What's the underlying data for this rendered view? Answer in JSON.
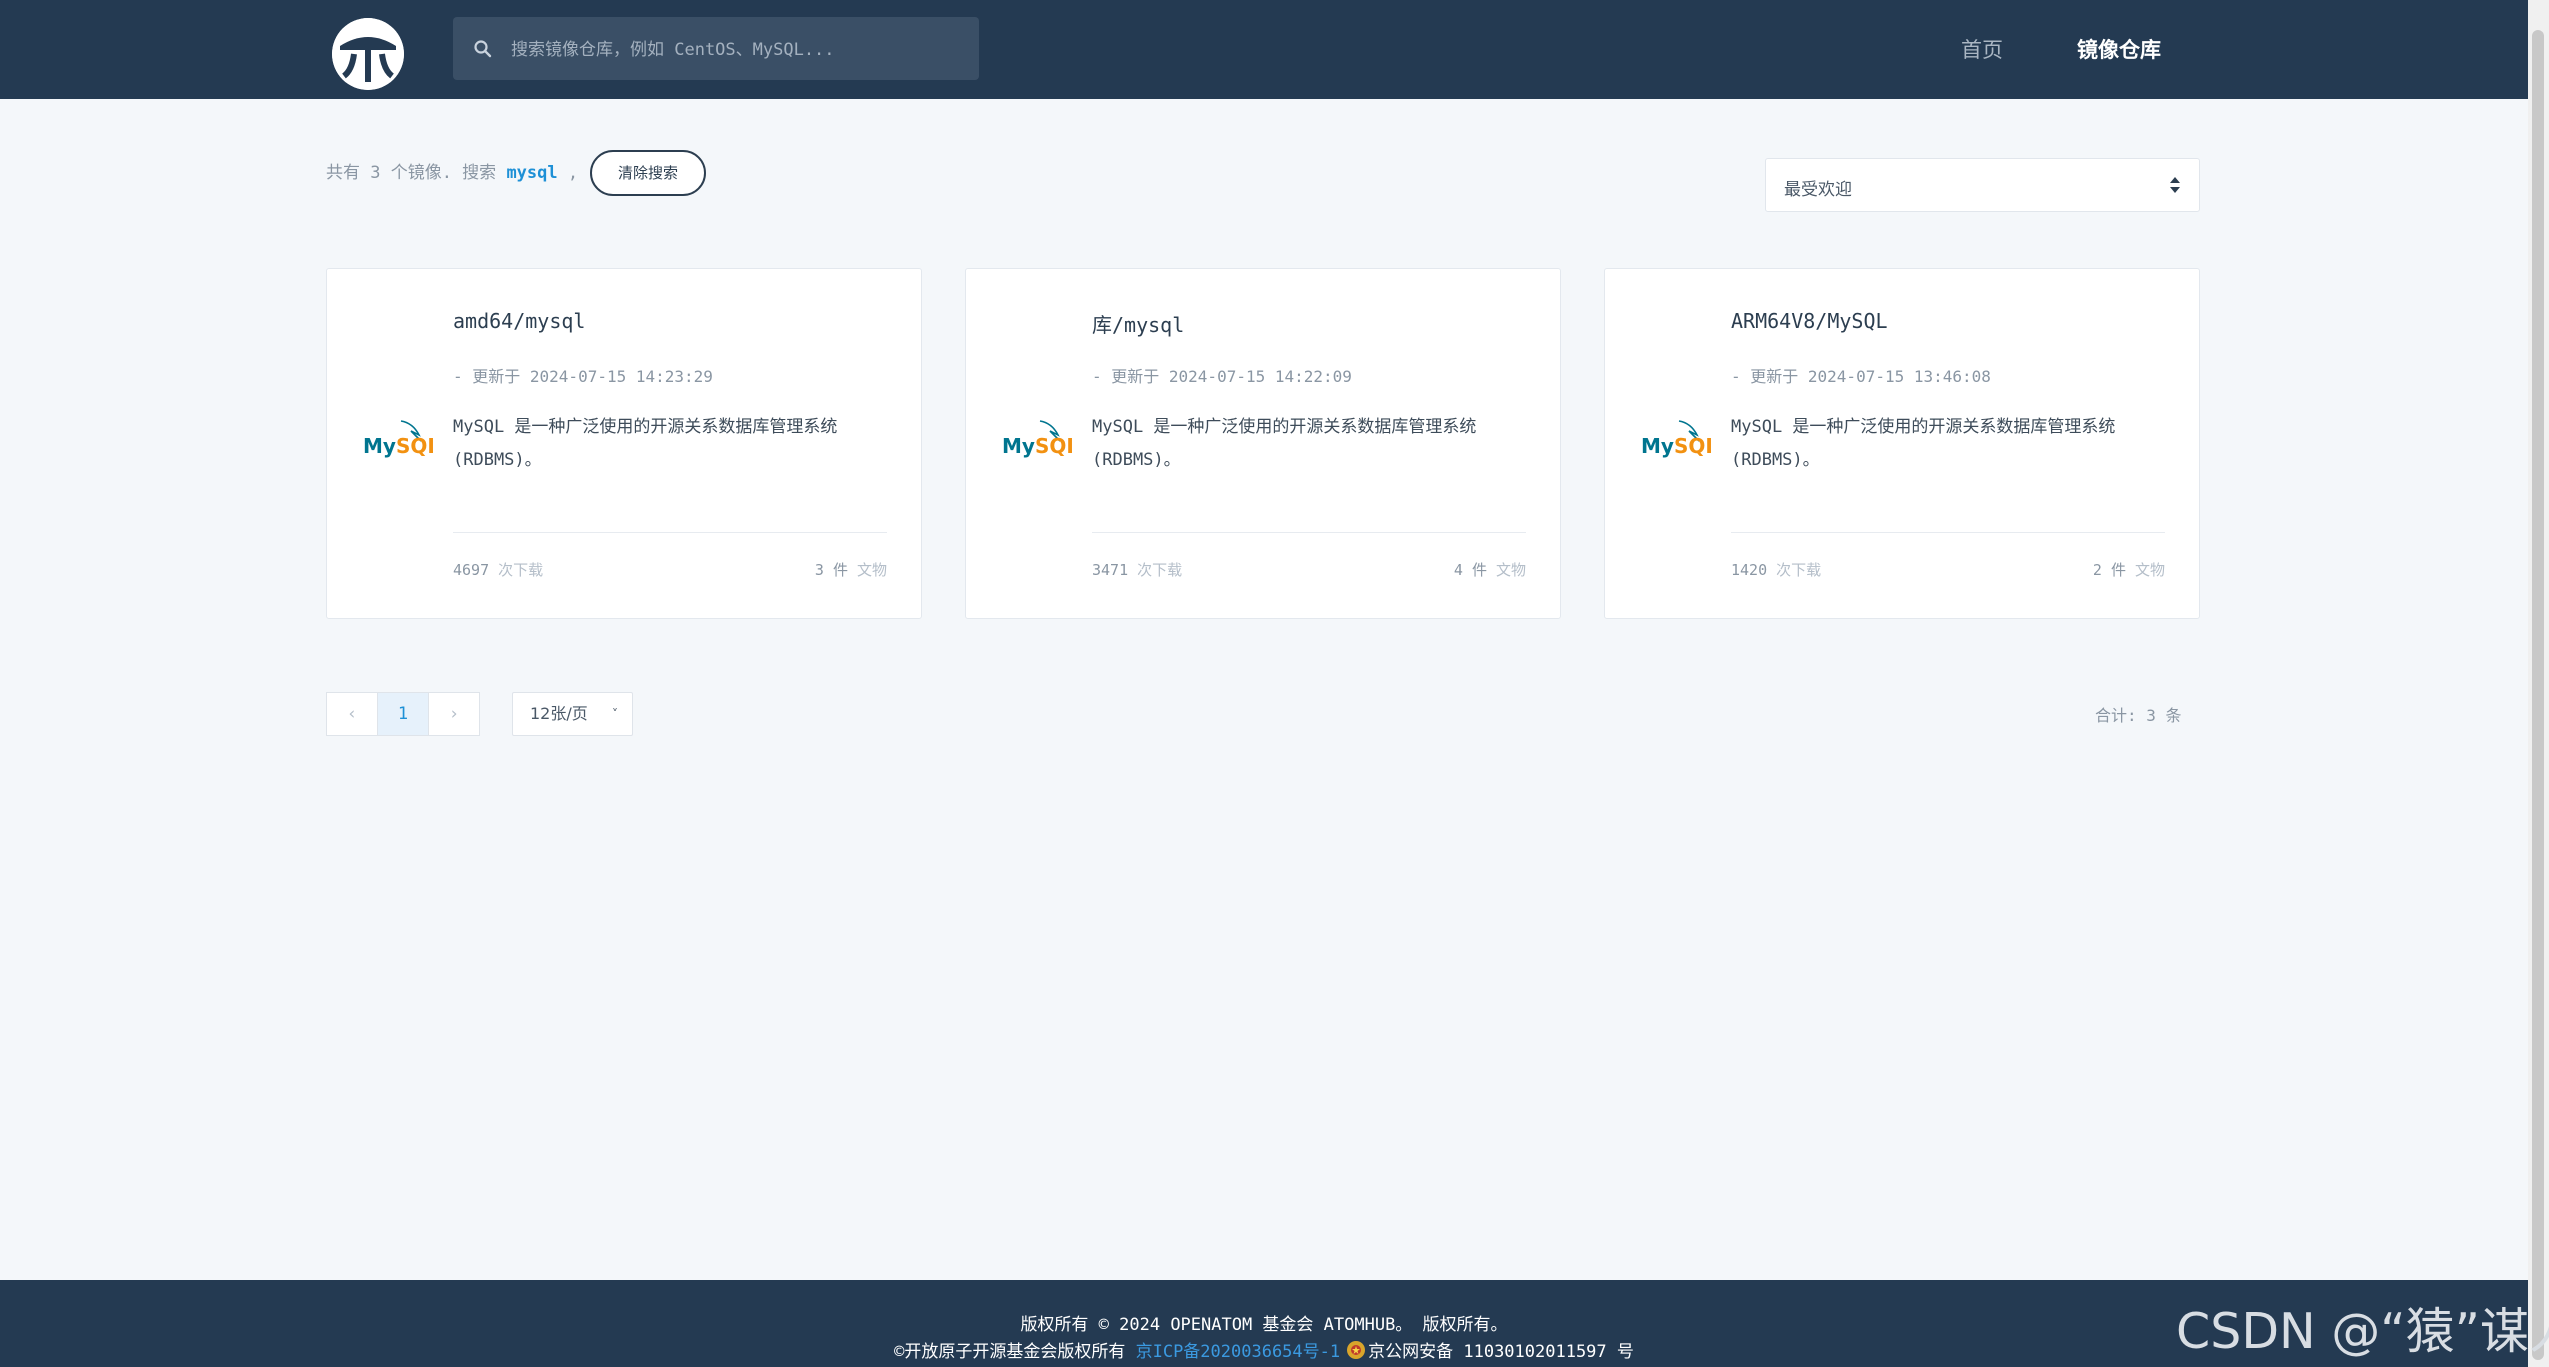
{
  "header": {
    "search_placeholder": "搜索镜像仓库，例如 CentOS、MySQL...",
    "nav": {
      "home": "首页",
      "repository": "镜像仓库"
    }
  },
  "summary": {
    "prefix": "共有 3 个镜像. 搜索",
    "keyword": "mysql",
    "separator": ",",
    "clear_label": "清除搜索"
  },
  "sort": {
    "selected": "最受欢迎"
  },
  "cards": [
    {
      "title": "amd64/mysql",
      "updated": "- 更新于 2024-07-15 14:23:29",
      "logo_label": "MySQL",
      "description": "MySQL 是一种广泛使用的开源关系数据库管理系统 (RDBMS)。",
      "downloads": "4697",
      "downloads_label": "次下载",
      "docs": "3 件",
      "docs_label": "文物"
    },
    {
      "title": "库/mysql",
      "updated": "- 更新于 2024-07-15 14:22:09",
      "logo_label": "MySQL",
      "description": "MySQL 是一种广泛使用的开源关系数据库管理系统 (RDBMS)。",
      "downloads": "3471",
      "downloads_label": "次下载",
      "docs": "4 件",
      "docs_label": "文物"
    },
    {
      "title": "ARM64V8/MySQL",
      "updated": "- 更新于 2024-07-15 13:46:08",
      "logo_label": "MySQL",
      "description": "MySQL 是一种广泛使用的开源关系数据库管理系统 (RDBMS)。",
      "downloads": "1420",
      "downloads_label": "次下载",
      "docs": "2 件",
      "docs_label": "文物"
    }
  ],
  "pagination": {
    "prev": "‹",
    "current": "1",
    "next": "›",
    "page_size": "12张/页",
    "page_size_chevron": "˅",
    "total": "合计: 3 条"
  },
  "footer": {
    "line1": "版权所有 © 2024 OPENATOM 基金会 ATOMHUB。 版权所有。",
    "copyright": "©开放原子开源基金会版权所有",
    "icp": "京ICP备2020036654号-1",
    "police": "京公网安备 11030102011597 号"
  },
  "watermark": "CSDN @“猿”谋人",
  "colors": {
    "header_bg": "#243a52",
    "accent": "#1e90d6",
    "page_bg": "#f4f7fa",
    "mysql_blue": "#00758f",
    "mysql_orange": "#f29111"
  }
}
